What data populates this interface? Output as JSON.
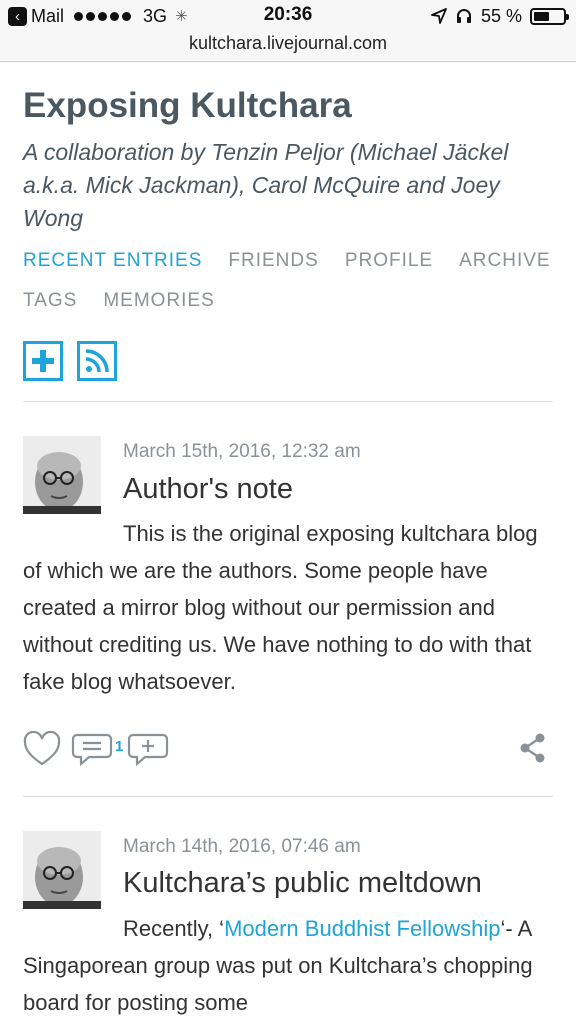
{
  "status_bar": {
    "back_app": "Mail",
    "network": "3G",
    "time": "20:36",
    "battery_text": "55 %",
    "battery_level": 0.55
  },
  "url_bar": {
    "domain": "kultchara.livejournal.com"
  },
  "blog": {
    "title": "Exposing Kultchara",
    "subtitle": "A collaboration by Tenzin Peljor (Michael Jäckel a.k.a. Mick Jackman), Carol McQuire and Joey Wong"
  },
  "nav": {
    "recent_entries": "RECENT ENTRIES",
    "friends": "FRIENDS",
    "profile": "PROFILE",
    "archive": "ARCHIVE",
    "tags": "TAGS",
    "memories": "MEMORIES"
  },
  "posts": [
    {
      "date": "March 15th, 2016, 12:32 am",
      "title": "Author's note",
      "body": "This is the original exposing kultchara blog of which we are the authors. Some people have created a mirror blog without our permission and without crediting us. We have nothing to do with that fake blog whatsoever.",
      "comment_count": "1"
    },
    {
      "date": "March 14th, 2016, 07:46 am",
      "title": "Kultchara’s public meltdown",
      "body_before": "Recently, ‘",
      "body_link": "Modern Buddhist Fellowship",
      "body_after": "‘- A Singaporean group was put on Kultchara’s chopping board for posting some"
    }
  ],
  "colors": {
    "accent": "#1da4d8",
    "title": "#4b5861",
    "muted": "#8a9298",
    "divider": "#d9dde0"
  }
}
